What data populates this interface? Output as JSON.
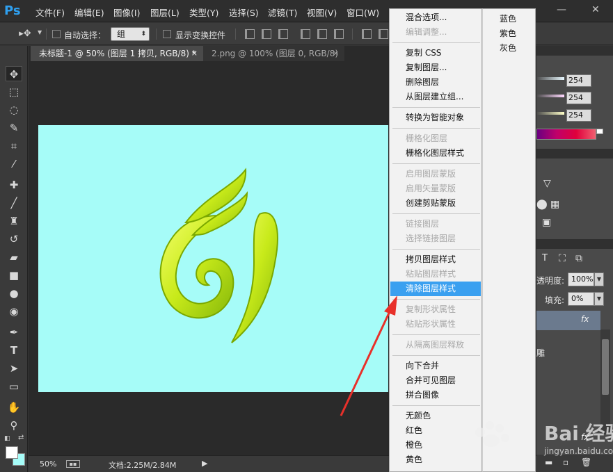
{
  "app": {
    "logo": "Ps"
  },
  "menu": [
    "文件(F)",
    "编辑(E)",
    "图像(I)",
    "图层(L)",
    "类型(Y)",
    "选择(S)",
    "滤镜(T)",
    "视图(V)",
    "窗口(W)"
  ],
  "window_controls": {
    "minimize": "—",
    "close": "✕"
  },
  "options": {
    "auto_select_label": "自动选择：",
    "auto_select_value": "组",
    "show_transform_label": "显示变换控件"
  },
  "tabs": [
    {
      "label": "未标题-1 @ 50% (图层 1 拷贝, RGB/8) *",
      "close": "×"
    },
    {
      "label": "2.png @ 100% (图层 0, RGB/8)",
      "close": "×"
    }
  ],
  "status": {
    "zoom": "50%",
    "doc_info": "文档:2.25M/2.84M",
    "arrow": "▶"
  },
  "color_panel": {
    "values": [
      "254",
      "254",
      "254"
    ]
  },
  "layers_panel": {
    "opacity_label": "透明度:",
    "opacity_value": "100%",
    "fill_label": "填充:",
    "fill_value": "0%",
    "fx": "fx",
    "partial_char": "雕"
  },
  "context_menu": [
    {
      "label": "混合选项...",
      "disabled": false
    },
    {
      "label": "编辑调整...",
      "disabled": true
    },
    {
      "sep": true
    },
    {
      "label": "复制 CSS",
      "disabled": false
    },
    {
      "label": "复制图层...",
      "disabled": false
    },
    {
      "label": "删除图层",
      "disabled": false
    },
    {
      "label": "从图层建立组...",
      "disabled": false
    },
    {
      "sep": true
    },
    {
      "label": "转换为智能对象",
      "disabled": false
    },
    {
      "sep": true
    },
    {
      "label": "栅格化图层",
      "disabled": true
    },
    {
      "label": "栅格化图层样式",
      "disabled": false
    },
    {
      "sep": true
    },
    {
      "label": "启用图层蒙版",
      "disabled": true
    },
    {
      "label": "启用矢量蒙版",
      "disabled": true
    },
    {
      "label": "创建剪贴蒙版",
      "disabled": false
    },
    {
      "sep": true
    },
    {
      "label": "链接图层",
      "disabled": true
    },
    {
      "label": "选择链接图层",
      "disabled": true
    },
    {
      "sep": true
    },
    {
      "label": "拷贝图层样式",
      "disabled": false
    },
    {
      "label": "粘贴图层样式",
      "disabled": true
    },
    {
      "label": "清除图层样式",
      "disabled": false,
      "highlighted": true
    },
    {
      "sep": true
    },
    {
      "label": "复制形状属性",
      "disabled": true
    },
    {
      "label": "粘贴形状属性",
      "disabled": true
    },
    {
      "sep": true
    },
    {
      "label": "从隔离图层释放",
      "disabled": true
    },
    {
      "sep": true
    },
    {
      "label": "向下合并",
      "disabled": false
    },
    {
      "label": "合并可见图层",
      "disabled": false
    },
    {
      "label": "拼合图像",
      "disabled": false
    },
    {
      "sep": true
    },
    {
      "label": "无颜色",
      "disabled": false
    },
    {
      "label": "红色",
      "disabled": false
    },
    {
      "label": "橙色",
      "disabled": false
    },
    {
      "label": "黄色",
      "disabled": false
    }
  ],
  "context_submenu": [
    "蓝色",
    "紫色",
    "灰色"
  ],
  "watermark": {
    "brand": "Bai  经验",
    "site": "jingyan.baidu.com"
  },
  "colors": {
    "canvas": "#a6fcf8",
    "highlight": "#3aa0f0",
    "arrow": "#e8302a"
  }
}
